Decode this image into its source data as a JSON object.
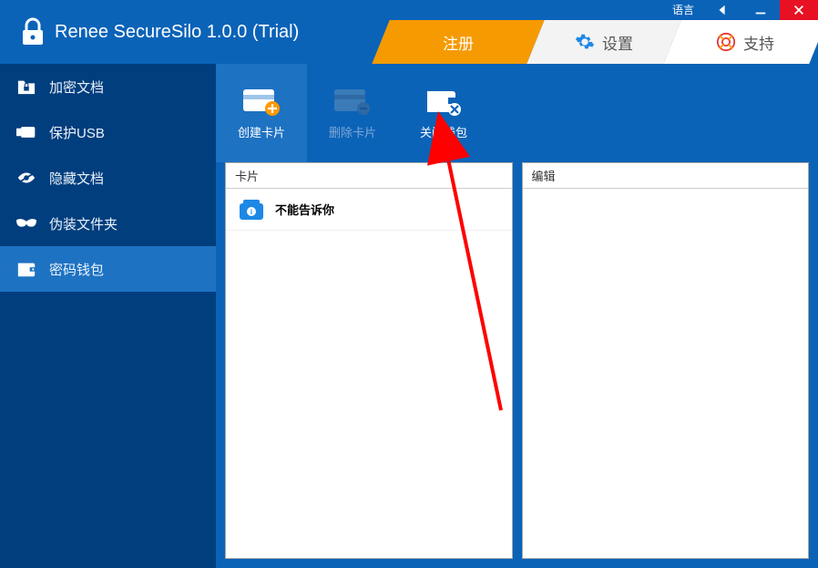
{
  "sysbar": {
    "language": "语言"
  },
  "header": {
    "title": "Renee SecureSilo 1.0.0 (Trial)",
    "tabs": [
      {
        "id": "register",
        "label": "注册"
      },
      {
        "id": "settings",
        "label": "设置"
      },
      {
        "id": "support",
        "label": "支持"
      }
    ]
  },
  "sidebar": {
    "items": [
      {
        "id": "encrypt",
        "label": "加密文档"
      },
      {
        "id": "usb",
        "label": "保护USB"
      },
      {
        "id": "hide",
        "label": "隐藏文档"
      },
      {
        "id": "disguise",
        "label": "伪装文件夹"
      },
      {
        "id": "wallet",
        "label": "密码钱包",
        "selected": true
      }
    ]
  },
  "toolbar": {
    "items": [
      {
        "id": "create-card",
        "label": "创建卡片",
        "selected": true
      },
      {
        "id": "delete-card",
        "label": "删除卡片",
        "disabled": true
      },
      {
        "id": "close-wallet",
        "label": "关闭钱包"
      }
    ]
  },
  "panes": {
    "cards": {
      "title": "卡片",
      "items": [
        {
          "name": "不能告诉你"
        }
      ]
    },
    "edit": {
      "title": "编辑"
    }
  },
  "colors": {
    "header_blue": "#0b63b8",
    "sidebar_dark": "#003e7e",
    "selected_blue": "#1e72c2",
    "accent_orange": "#f59a00",
    "close_red": "#e81123"
  }
}
